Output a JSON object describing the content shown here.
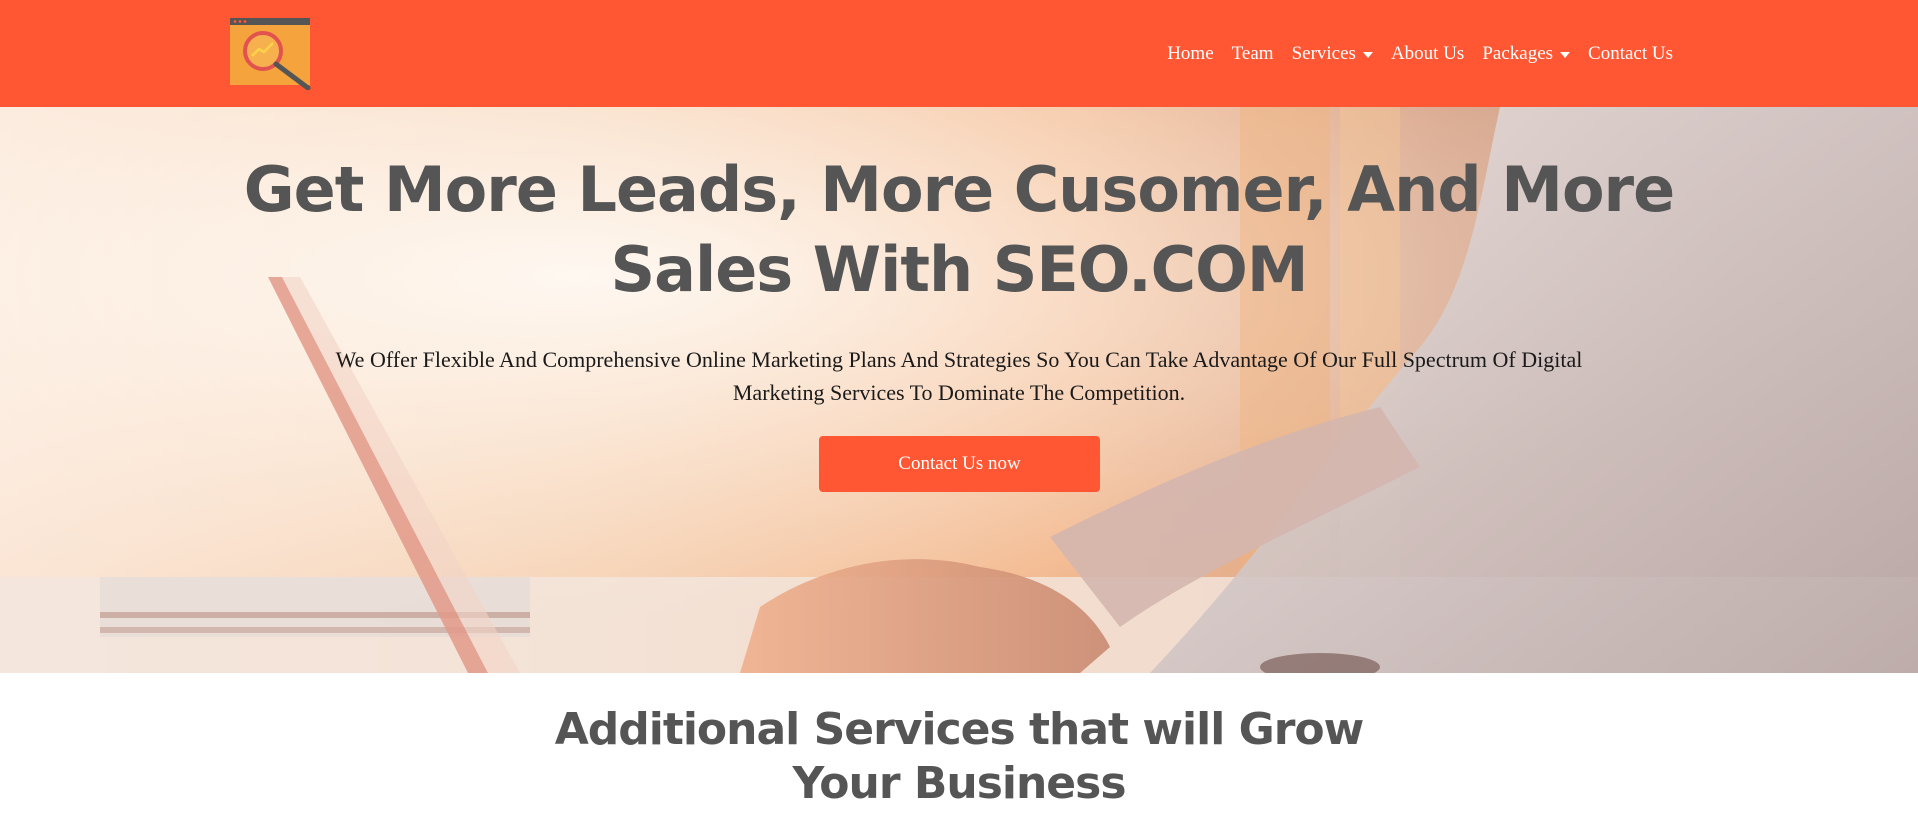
{
  "nav": {
    "items": [
      {
        "label": "Home",
        "dropdown": false
      },
      {
        "label": "Team",
        "dropdown": false
      },
      {
        "label": "Services",
        "dropdown": true
      },
      {
        "label": "About Us",
        "dropdown": false
      },
      {
        "label": "Packages",
        "dropdown": true
      },
      {
        "label": "Contact Us",
        "dropdown": false
      }
    ]
  },
  "hero": {
    "title_line1": "Get More Leads, More Cusomer, And More",
    "title_line2": "Sales With SEO.COM",
    "subtitle_line1": "We Offer Flexible And Comprehensive Online Marketing Plans And Strategies So You Can Take Advantage Of Our Full Spectrum Of Digital",
    "subtitle_line2": "Marketing Services To Dominate The Competition.",
    "cta_label": "Contact Us now"
  },
  "section": {
    "title_line1": "Additional Services that will Grow",
    "title_line2": "Your Business"
  },
  "colors": {
    "brand": "#ff5733",
    "heading": "#555555",
    "white": "#ffffff"
  },
  "icons": {
    "logo": "seo-magnifier-logo-icon",
    "dropdown": "caret-down-icon"
  }
}
